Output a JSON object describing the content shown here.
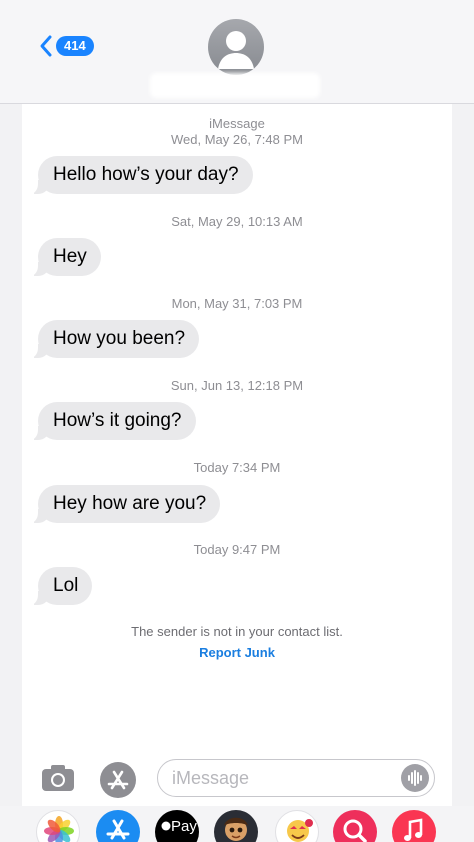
{
  "header": {
    "back_count": "414",
    "contact_name": ""
  },
  "thread": {
    "service": "iMessage",
    "messages": [
      {
        "time": "Wed, May 26, 7:48 PM",
        "text": "Hello how’s your day?"
      },
      {
        "time": "Sat, May 29, 10:13 AM",
        "text": "Hey"
      },
      {
        "time": "Mon, May 31, 7:03 PM",
        "text": "How you been?"
      },
      {
        "time": "Sun, Jun 13, 12:18 PM",
        "text": "How’s it going?"
      },
      {
        "time": "Today 7:34 PM",
        "text": "Hey how are you?"
      },
      {
        "time": "Today 9:47 PM",
        "text": "Lol"
      }
    ],
    "notice": "The sender is not in your contact list.",
    "report_link": "Report Junk"
  },
  "composer": {
    "placeholder": "iMessage",
    "value": ""
  },
  "app_drawer": {
    "apps": [
      {
        "name": "photos-app-icon"
      },
      {
        "name": "app-store-icon"
      },
      {
        "name": "apple-pay-icon",
        "label": "Pay"
      },
      {
        "name": "memoji-icon"
      },
      {
        "name": "animoji-icon"
      },
      {
        "name": "image-search-icon"
      },
      {
        "name": "music-icon"
      }
    ]
  },
  "colors": {
    "accent": "#1a84ff",
    "bubble": "#e9e9eb",
    "link": "#1a7ee0"
  }
}
